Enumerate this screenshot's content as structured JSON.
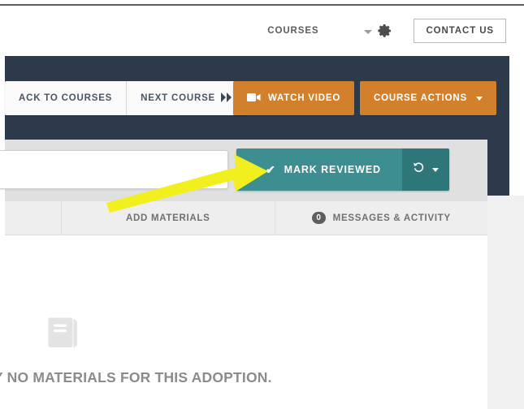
{
  "utility_bar": {
    "courses_label": "COURSES",
    "settings_icon": "gear-icon",
    "settings_caret_icon": "caret-down-icon",
    "contact_label": "CONTACT US"
  },
  "action_bar": {
    "back_label": "ACK TO COURSES",
    "next_label": "NEXT COURSE",
    "next_icon": "fast-forward-icon",
    "watch_video_label": "WATCH VIDEO",
    "watch_video_icon": "video-camera-icon",
    "course_actions_label": "COURSE ACTIONS",
    "course_actions_caret": "caret-down-icon",
    "background_color": "#2c3a4b",
    "orange_color": "#d2802b"
  },
  "review_row": {
    "input_value": "",
    "input_placeholder": "",
    "mark_reviewed_label": "MARK REVIEWED",
    "check_icon": "check-icon",
    "undo_icon": "undo-history-icon",
    "split_caret_icon": "caret-down-icon",
    "teal_color": "#3c8e90",
    "teal_split_color": "#2f7678"
  },
  "tabs": [
    {
      "label": "ADD MATERIALS",
      "badge": null
    },
    {
      "label": "MESSAGES & ACTIVITY",
      "badge": "0"
    }
  ],
  "content": {
    "empty_icon": "book-icon",
    "empty_message": "Y NO MATERIALS FOR THIS ADOPTION."
  },
  "annotation": {
    "arrow_color": "#f2ef1e",
    "arrow_icon": "pointer-arrow-annotation"
  }
}
